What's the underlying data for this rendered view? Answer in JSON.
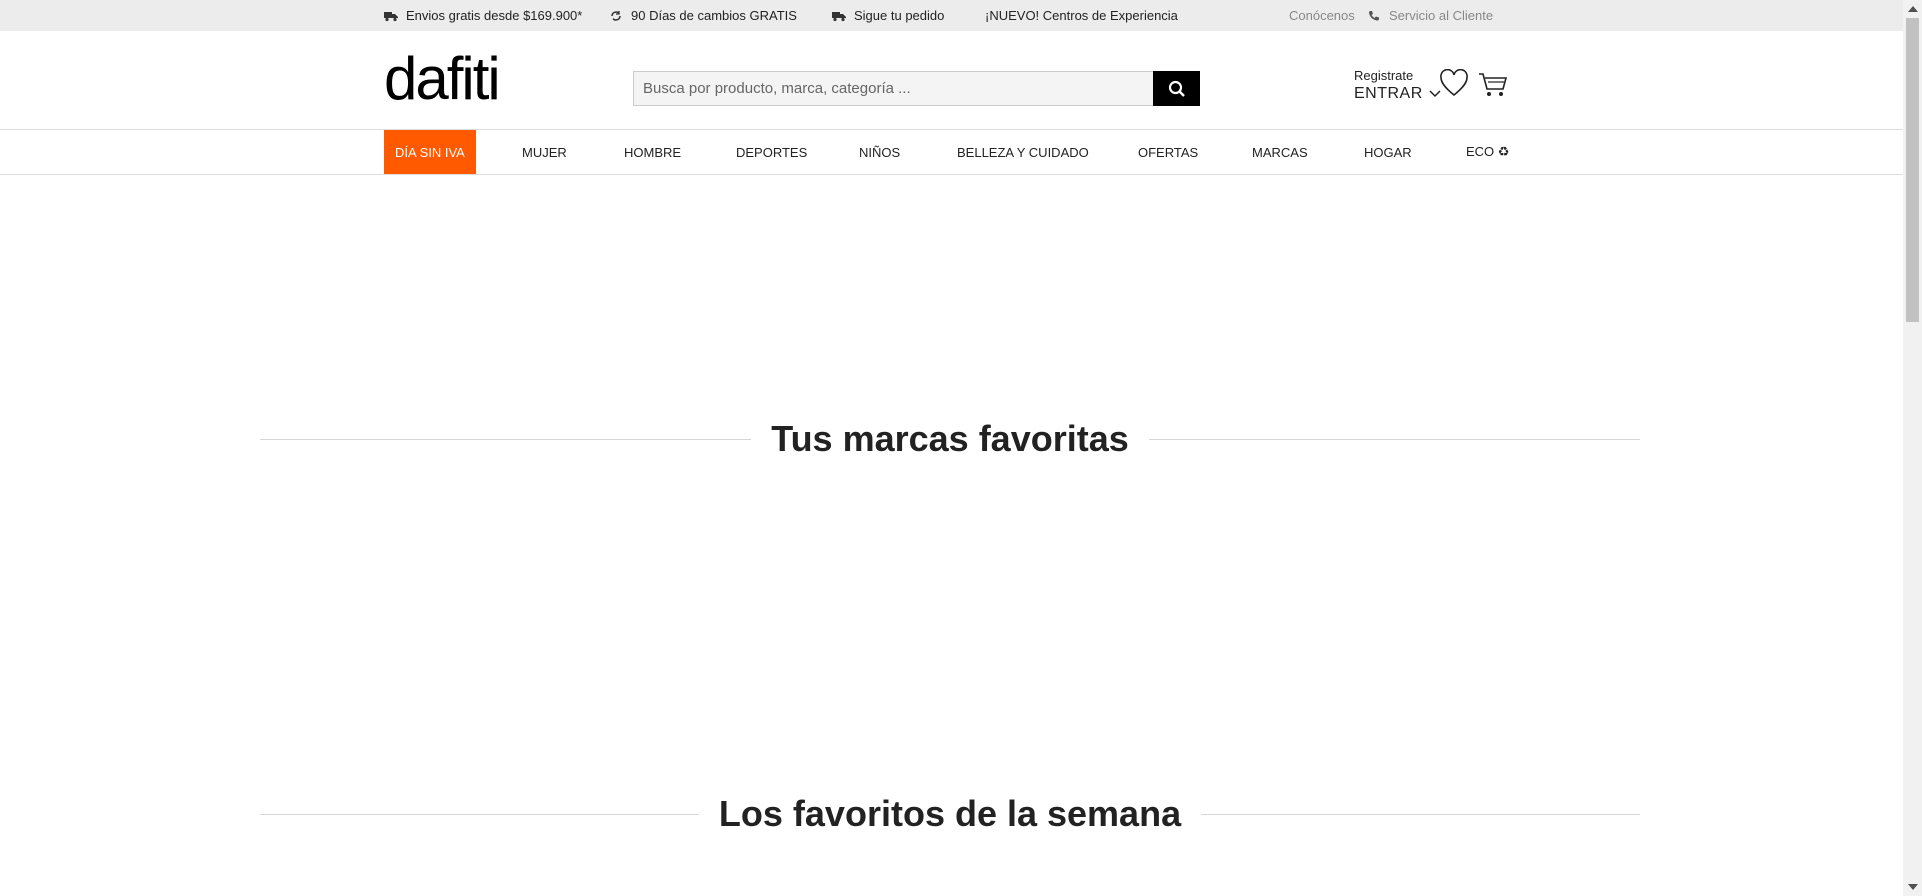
{
  "topbar": {
    "shipping": "Envios gratis desde $169.900*",
    "returns": "90 Días de cambios GRATIS",
    "tracking": "Sigue tu pedido",
    "experience": "¡NUEVO! Centros de Experiencia",
    "about": "Conócenos",
    "support": "Servicio al Cliente"
  },
  "header": {
    "logo": "dafiti",
    "search_placeholder": "Busca por producto, marca, categoría ...",
    "register": "Registrate",
    "enter": "ENTRAR"
  },
  "nav": {
    "items": [
      "DÍA SIN IVA",
      "MUJER",
      "HOMBRE",
      "DEPORTES",
      "NIÑOS",
      "BELLEZA Y CUIDADO",
      "OFERTAS",
      "MARCAS",
      "HOGAR",
      "ECO ♻"
    ]
  },
  "sections": {
    "brands": "Tus marcas favoritas",
    "weekly": "Los favoritos de la semana"
  },
  "colors": {
    "accent": "#ff5a00",
    "topbar_bg": "#ececec"
  }
}
